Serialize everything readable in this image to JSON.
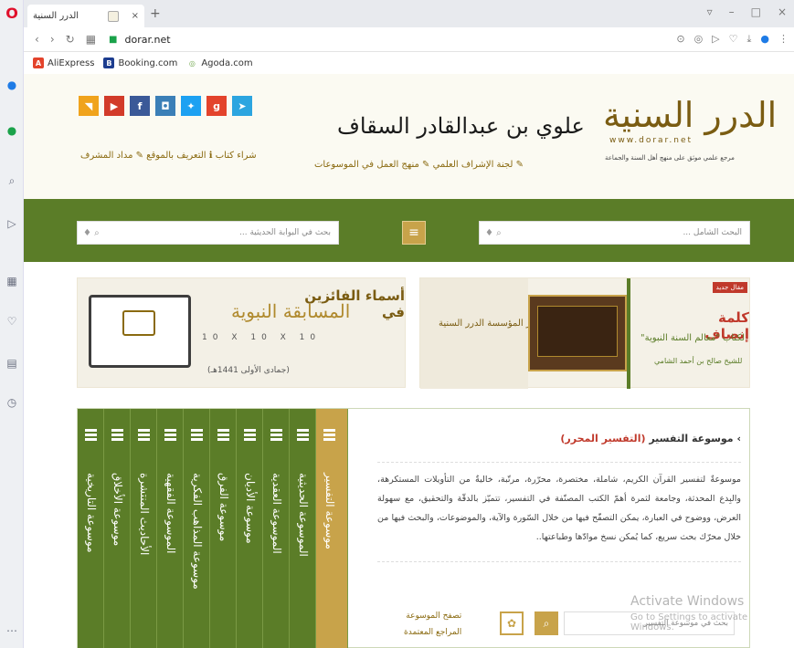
{
  "browser": {
    "tab_title": "الدرر السنية",
    "url": "dorar.net",
    "bookmarks": [
      "AliExpress",
      "Booking.com",
      "Agoda.com"
    ]
  },
  "header": {
    "logo_text": "الدرر السنية",
    "logo_url": "www.dorar.net",
    "tagline": "مرجع علمي موثق على منهج أهل السنة والجماعة",
    "signature": "علوي بن عبدالقادر السقاف",
    "links_left": "شراء كتاب ℹ التعريف بالموقع ✎ مداد المشرف",
    "links_center": "✎ لجنة الإشراف العلمي ✎ منهج العمل في الموسوعات"
  },
  "search": {
    "right_placeholder": "البحث الشامل ...",
    "left_placeholder": "بحث في البوابة الحديثية ...",
    "menu_glyph": "≡"
  },
  "banners": {
    "winners": {
      "title": "أسماء الفائزين في",
      "subtitle": "المسابقة النبوية",
      "nums": "10 X 10 X 10",
      "date": "(جمادى الأولى 1441هـ)"
    },
    "kalima": {
      "badge": "مقال جديد",
      "title": "كلمة إنصاف",
      "subtitle": "لكتاب \"معالم السنة النبوية\"",
      "author": "للشيخ صالح بن أحمد الشامي",
      "left_text": "إصدار المؤسسة الدرر السنية"
    }
  },
  "encyclopedia": {
    "title_prefix": "موسوعة التفسير",
    "title_highlight": "(التفسير المحرر)",
    "description": "موسوعةٌ لتفسير القرآن الكريم، شاملة، مختصرة، محرّرة، مرتّبة، خاليةٌ من التأويلات المستكرهة، والبِدع المحدثة، وجامعة لثمرة أهمّ الكتب المصنّفة في التفسير، تتميّز بالدقّة والتحقيق، مع سهولة العرض، ووضوح في العبارة، يمكن التصفّح فيها من خلال السّورة والآية، والموضوعات، والبحث فيها من خلال محرّك بحث سريع، كما يُمكن نسخ موادّها وطباعتها..",
    "link1": "تصفح الموسوعة",
    "link2": "المراجع المعتمدة",
    "search_placeholder": "بحث في موسوعة التفسير",
    "spines": [
      "موسوعة التاريخية",
      "موسوعة الأخلاق",
      "الأحاديث المنتشرة",
      "الموسوعة الفقهية",
      "موسوعة المذاهب الفكرية",
      "موسوعة الفرق",
      "موسوعة الأديان",
      "الموسوعة العقدية",
      "الموسوعة الحديثية",
      "موسوعة التفسير"
    ]
  },
  "watermark": {
    "line1": "Activate Windows",
    "line2": "Go to Settings to activate Windows."
  }
}
